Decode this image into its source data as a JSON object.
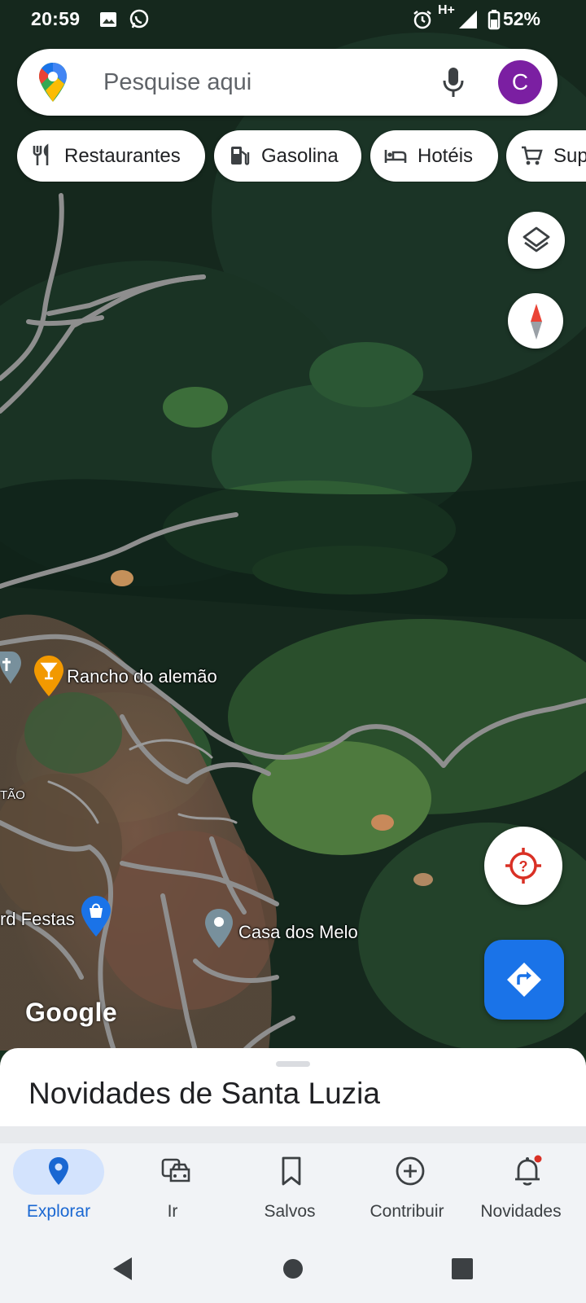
{
  "status_bar": {
    "time": "20:59",
    "network": "H+",
    "battery": "52%",
    "icons": [
      "image-icon",
      "whatsapp-icon",
      "alarm-icon",
      "signal-icon",
      "battery-icon"
    ]
  },
  "search": {
    "placeholder": "Pesquise aqui",
    "avatar_letter": "C",
    "avatar_color": "#7b1fa2"
  },
  "chips": [
    {
      "label": "Restaurantes",
      "icon": "fork-knife-icon"
    },
    {
      "label": "Gasolina",
      "icon": "gas-pump-icon"
    },
    {
      "label": "Hotéis",
      "icon": "bed-icon"
    },
    {
      "label": "Supermercados",
      "icon": "cart-icon"
    }
  ],
  "map": {
    "places": [
      {
        "name": "Rancho do alemão",
        "icon": "bar-pin-icon"
      },
      {
        "name": "Casa dos Melo",
        "icon": "place-pin-icon"
      },
      {
        "name": "rd Festas",
        "icon": "shopping-pin-icon"
      }
    ],
    "partial_label": "TÃO",
    "attribution": "Google"
  },
  "sheet": {
    "title": "Novidades de Santa Luzia"
  },
  "bottom_nav": [
    {
      "label": "Explorar",
      "icon": "location-pin-icon",
      "active": true
    },
    {
      "label": "Ir",
      "icon": "commute-icon",
      "active": false
    },
    {
      "label": "Salvos",
      "icon": "bookmark-icon",
      "active": false
    },
    {
      "label": "Contribuir",
      "icon": "add-circle-icon",
      "active": false
    },
    {
      "label": "Novidades",
      "icon": "bell-icon",
      "active": false
    }
  ],
  "colors": {
    "accent": "#1a73e8",
    "active_nav": "#1967d2",
    "active_pill": "#d3e3fd",
    "notification_dot": "#d93025"
  }
}
